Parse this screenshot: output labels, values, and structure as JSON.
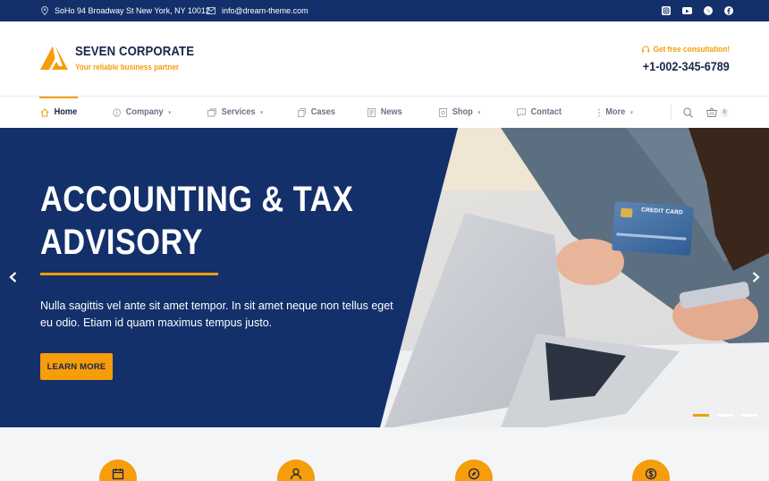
{
  "topbar": {
    "address": "SoHo 94 Broadway St New York, NY 10012",
    "email": "info@dream-theme.com",
    "socials": [
      "instagram-icon",
      "youtube-icon",
      "whatsapp-icon",
      "facebook-icon"
    ]
  },
  "brand": {
    "title": "SEVEN CORPORATE",
    "tagline": "Your reliable business partner",
    "consultation": "Get free consultation!",
    "phone": "+1-002-345-6789"
  },
  "nav": {
    "items": [
      {
        "label": "Home",
        "icon": "home-icon",
        "active": true,
        "dropdown": false
      },
      {
        "label": "Company",
        "icon": "info-icon",
        "active": false,
        "dropdown": true
      },
      {
        "label": "Services",
        "icon": "services-icon",
        "active": false,
        "dropdown": true
      },
      {
        "label": "Cases",
        "icon": "cases-icon",
        "active": false,
        "dropdown": false
      },
      {
        "label": "News",
        "icon": "news-icon",
        "active": false,
        "dropdown": false
      },
      {
        "label": "Shop",
        "icon": "shop-icon",
        "active": false,
        "dropdown": true
      },
      {
        "label": "Contact",
        "icon": "chat-icon",
        "active": false,
        "dropdown": false
      },
      {
        "label": "More",
        "icon": "more-icon",
        "active": false,
        "dropdown": true
      }
    ],
    "cart_count": "0"
  },
  "hero": {
    "title_line1": "ACCOUNTING & TAX",
    "title_line2": "ADVISORY",
    "text": "Nulla sagittis vel ante sit amet tempor. In sit amet neque non tellus eget eu odio. Etiam id quam maximus tempus justo.",
    "button": "LEARN MORE",
    "card_label": "CREDIT CARD",
    "slides": 3,
    "active_slide": 1
  },
  "features": {
    "icons": [
      "calendar-icon",
      "user-icon",
      "compass-icon",
      "dollar-icon"
    ]
  },
  "colors": {
    "navy": "#13306b",
    "accent": "#f59d0b",
    "dark_text": "#1a2547"
  }
}
